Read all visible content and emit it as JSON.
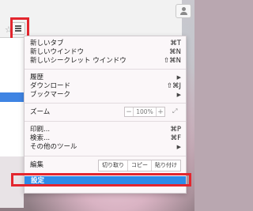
{
  "colors": {
    "highlight_box": "#e3262e",
    "selected_item_bg": "#2d8be8",
    "selected_item_text": "#ffffff",
    "menu_bg": "#fbf7f9"
  },
  "toolbar": {
    "menu_icon": "hamburger-menu-icon",
    "user_icon": "user-icon",
    "bookmark_icon": "star-icon"
  },
  "menu": {
    "group1": [
      {
        "label": "新しいタブ",
        "shortcut": "⌘T"
      },
      {
        "label": "新しいウインドウ",
        "shortcut": "⌘N"
      },
      {
        "label": "新しいシークレット ウインドウ",
        "shortcut": "⇧⌘N"
      }
    ],
    "group2": [
      {
        "label": "履歴",
        "arrow": "▶"
      },
      {
        "label": "ダウンロード",
        "shortcut": "⇧⌘J"
      },
      {
        "label": "ブックマーク",
        "arrow": "▶"
      }
    ],
    "zoom": {
      "label": "ズーム",
      "minus": "−",
      "value": "100%",
      "plus": "+",
      "fullscreen_icon": "fullscreen-icon"
    },
    "group3": [
      {
        "label": "印刷...",
        "shortcut": "⌘P"
      },
      {
        "label": "検索...",
        "shortcut": "⌘F"
      },
      {
        "label": "その他のツール",
        "arrow": "▶"
      }
    ],
    "edit": {
      "label": "編集",
      "cut": "切り取り",
      "copy": "コピー",
      "paste": "貼り付け"
    },
    "settings": {
      "label": "設定"
    }
  }
}
